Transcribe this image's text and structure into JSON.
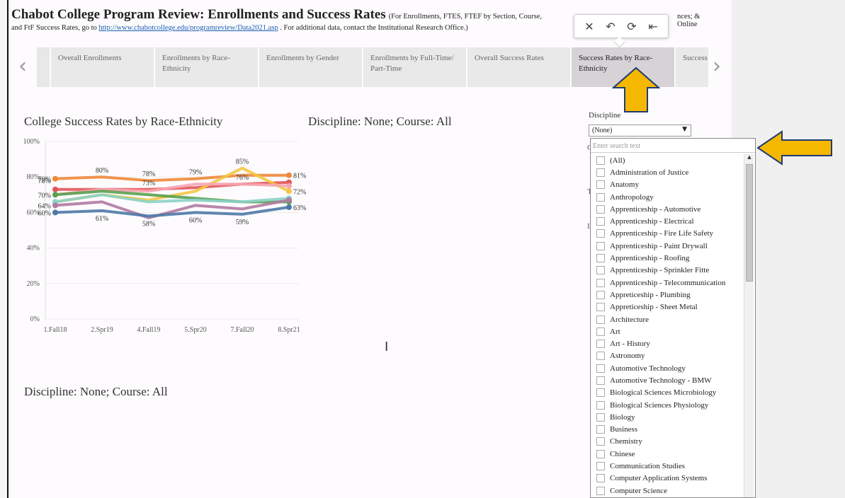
{
  "header": {
    "title": "Chabot College Program Review: Enrollments and Success Rates",
    "note_left": "(For Enrollments, FTES, FTEF by Section, Course,",
    "note_right": "nces; & Online",
    "line2_prefix": "and FtF Success Rates, go to ",
    "link_text": "http://www.chabotcollege.edu/programreview/Data2021.asp",
    "line2_suffix": " . For additional data, contact the Institutional Research Office.)"
  },
  "toolbar": {
    "close": "✕",
    "undo": "↶",
    "refresh": "⟳",
    "exit": "⇤"
  },
  "nav": {
    "prev": "‹",
    "next": "›"
  },
  "tabs": [
    "Overall Enrollments",
    "Enrollments by Race-Ethnicity",
    "Enrollments by Gender",
    "Enrollments by Full-Time/ Part-Time",
    "Overall Success Rates",
    "Success Rates by Race-Ethnicity",
    "Success"
  ],
  "main": {
    "chart_title": "College Success Rates by Race-Ethnicity",
    "subtitle_top": "Discipline: None; Course: All",
    "subtitle_bottom": "Discipline: None; Course: All"
  },
  "filter": {
    "label": "Discipline",
    "selected": "(None)",
    "search_placeholder": "Enter search text",
    "options": [
      "(All)",
      "Administration of Justice",
      "Anatomy",
      "Anthropology",
      "Apprenticeship - Automotive",
      "Apprenticeship - Electrical",
      "Apprenticeship - Fire Life Safety",
      "Apprenticeship - Paint Drywall",
      "Apprenticeship - Roofing",
      "Apprenticeship - Sprinkler Fitte",
      "Apprenticeship - Telecommunication",
      "Appreticeship - Plumbing",
      "Appreticeship - Sheet Metal",
      "Architecture",
      "Art",
      "Art - History",
      "Astronomy",
      "Automotive Technology",
      "Automotive Technology - BMW",
      "Biological Sciences Microbiology",
      "Biological Sciences Physiology",
      "Biology",
      "Business",
      "Chemistry",
      "Chinese",
      "Communication Studies",
      "Computer Application Systems",
      "Computer Science"
    ],
    "hidden_letters": [
      "C",
      "T",
      "I"
    ]
  },
  "colors": {
    "highlight_arrow": "#f5b800",
    "active_tab": "#d6d2d6"
  },
  "chart_data": {
    "type": "line",
    "categories": [
      "1.Fall18",
      "2.Spr19",
      "4.Fall19",
      "5.Spr20",
      "7.Fall20",
      "8.Spr21"
    ],
    "ylim": [
      0,
      100
    ],
    "yticks": [
      "0%",
      "20%",
      "40%",
      "60%",
      "80%",
      "100%"
    ],
    "series": [
      {
        "color": "#f0883a",
        "values": [
          79,
          80,
          78,
          79,
          81,
          81
        ]
      },
      {
        "color": "#e15759",
        "values": [
          73,
          73,
          73,
          74,
          76,
          77
        ]
      },
      {
        "color": "#f4c542",
        "values": [
          66,
          70,
          67,
          72,
          85,
          72
        ]
      },
      {
        "color": "#f6a5b4",
        "values": [
          70,
          73,
          72,
          76,
          76,
          75
        ]
      },
      {
        "color": "#59a14f",
        "values": [
          70,
          72,
          70,
          68,
          66,
          66
        ]
      },
      {
        "color": "#8cd1c7",
        "values": [
          66,
          70,
          66,
          67,
          66,
          68
        ]
      },
      {
        "color": "#b07aa1",
        "values": [
          64,
          66,
          57,
          64,
          62,
          67
        ]
      },
      {
        "color": "#4e79a7",
        "values": [
          60,
          61,
          58,
          60,
          59,
          63
        ]
      }
    ],
    "data_labels": [
      {
        "text": "79%",
        "category": 0,
        "value": 79
      },
      {
        "text": "78%",
        "category": 0,
        "value": 78
      },
      {
        "text": "70%",
        "category": 0,
        "value": 70
      },
      {
        "text": "64%",
        "category": 0,
        "value": 64
      },
      {
        "text": "60%",
        "category": 0,
        "value": 60
      },
      {
        "text": "80%",
        "category": 1,
        "value": 80
      },
      {
        "text": "61%",
        "category": 1,
        "value": 61
      },
      {
        "text": "78%",
        "category": 2,
        "value": 78
      },
      {
        "text": "73%",
        "category": 2,
        "value": 73
      },
      {
        "text": "58%",
        "category": 2,
        "value": 58
      },
      {
        "text": "79%",
        "category": 3,
        "value": 79
      },
      {
        "text": "60%",
        "category": 3,
        "value": 60
      },
      {
        "text": "85%",
        "category": 4,
        "value": 85
      },
      {
        "text": "76%",
        "category": 4,
        "value": 76
      },
      {
        "text": "59%",
        "category": 4,
        "value": 59
      },
      {
        "text": "81%",
        "category": 5,
        "value": 81
      },
      {
        "text": "72%",
        "category": 5,
        "value": 72
      },
      {
        "text": "63%",
        "category": 5,
        "value": 63
      }
    ]
  }
}
